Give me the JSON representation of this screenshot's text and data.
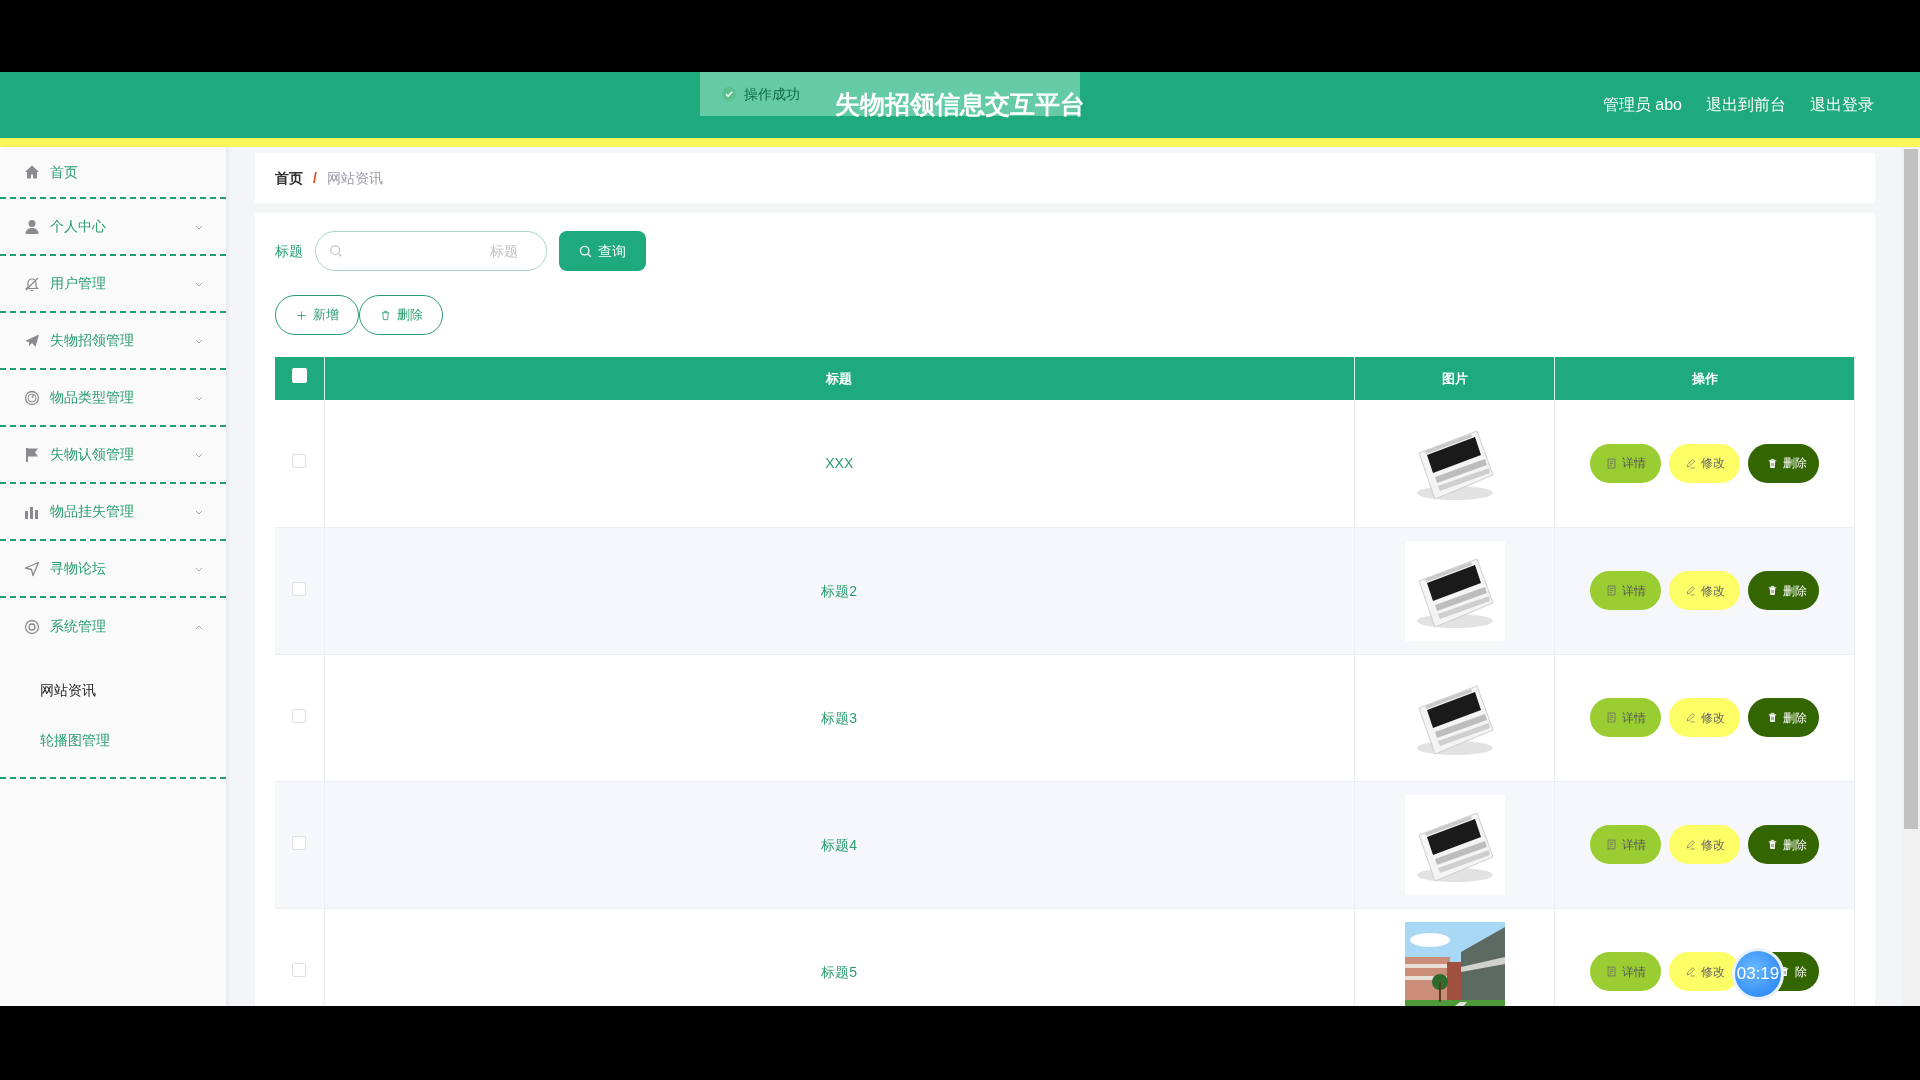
{
  "header": {
    "title": "失物招领信息交互平台",
    "links": [
      "管理员 abo",
      "退出到前台",
      "退出登录"
    ]
  },
  "toast": {
    "text": "操作成功"
  },
  "sidebar": {
    "items": [
      {
        "label": "首页"
      },
      {
        "label": "个人中心",
        "expanded": false
      },
      {
        "label": "用户管理",
        "expanded": false
      },
      {
        "label": "失物招领管理",
        "expanded": false
      },
      {
        "label": "物品类型管理",
        "expanded": false
      },
      {
        "label": "失物认领管理",
        "expanded": false
      },
      {
        "label": "物品挂失管理",
        "expanded": false
      },
      {
        "label": "寻物论坛",
        "expanded": false
      },
      {
        "label": "系统管理",
        "expanded": true,
        "children": [
          {
            "label": "网站资讯",
            "selected": true
          },
          {
            "label": "轮播图管理",
            "selected": false
          }
        ]
      }
    ]
  },
  "breadcrumb": {
    "items": [
      "首页",
      "网站资讯"
    ],
    "separator": "/"
  },
  "search": {
    "label": "标题",
    "placeholder": "标题",
    "button": "查询"
  },
  "actions": [
    "新增",
    "删除"
  ],
  "table": {
    "header_checked": false,
    "columns": [
      "标题",
      "图片",
      "操作"
    ],
    "rows": [
      {
        "checked": false,
        "title": "XXX",
        "actions": [
          "详情",
          "修改",
          "删除"
        ]
      },
      {
        "checked": false,
        "title": "标题2",
        "actions": [
          "详情",
          "修改",
          "删除"
        ]
      },
      {
        "checked": false,
        "title": "标题3",
        "actions": [
          "详情",
          "修改",
          "删除"
        ]
      },
      {
        "checked": false,
        "title": "标题4",
        "actions": [
          "详情",
          "修改",
          "删除"
        ]
      },
      {
        "checked": false,
        "title": "标题5",
        "actions": [
          "详情",
          "修改",
          "除"
        ]
      }
    ]
  },
  "timer": "03:19"
}
